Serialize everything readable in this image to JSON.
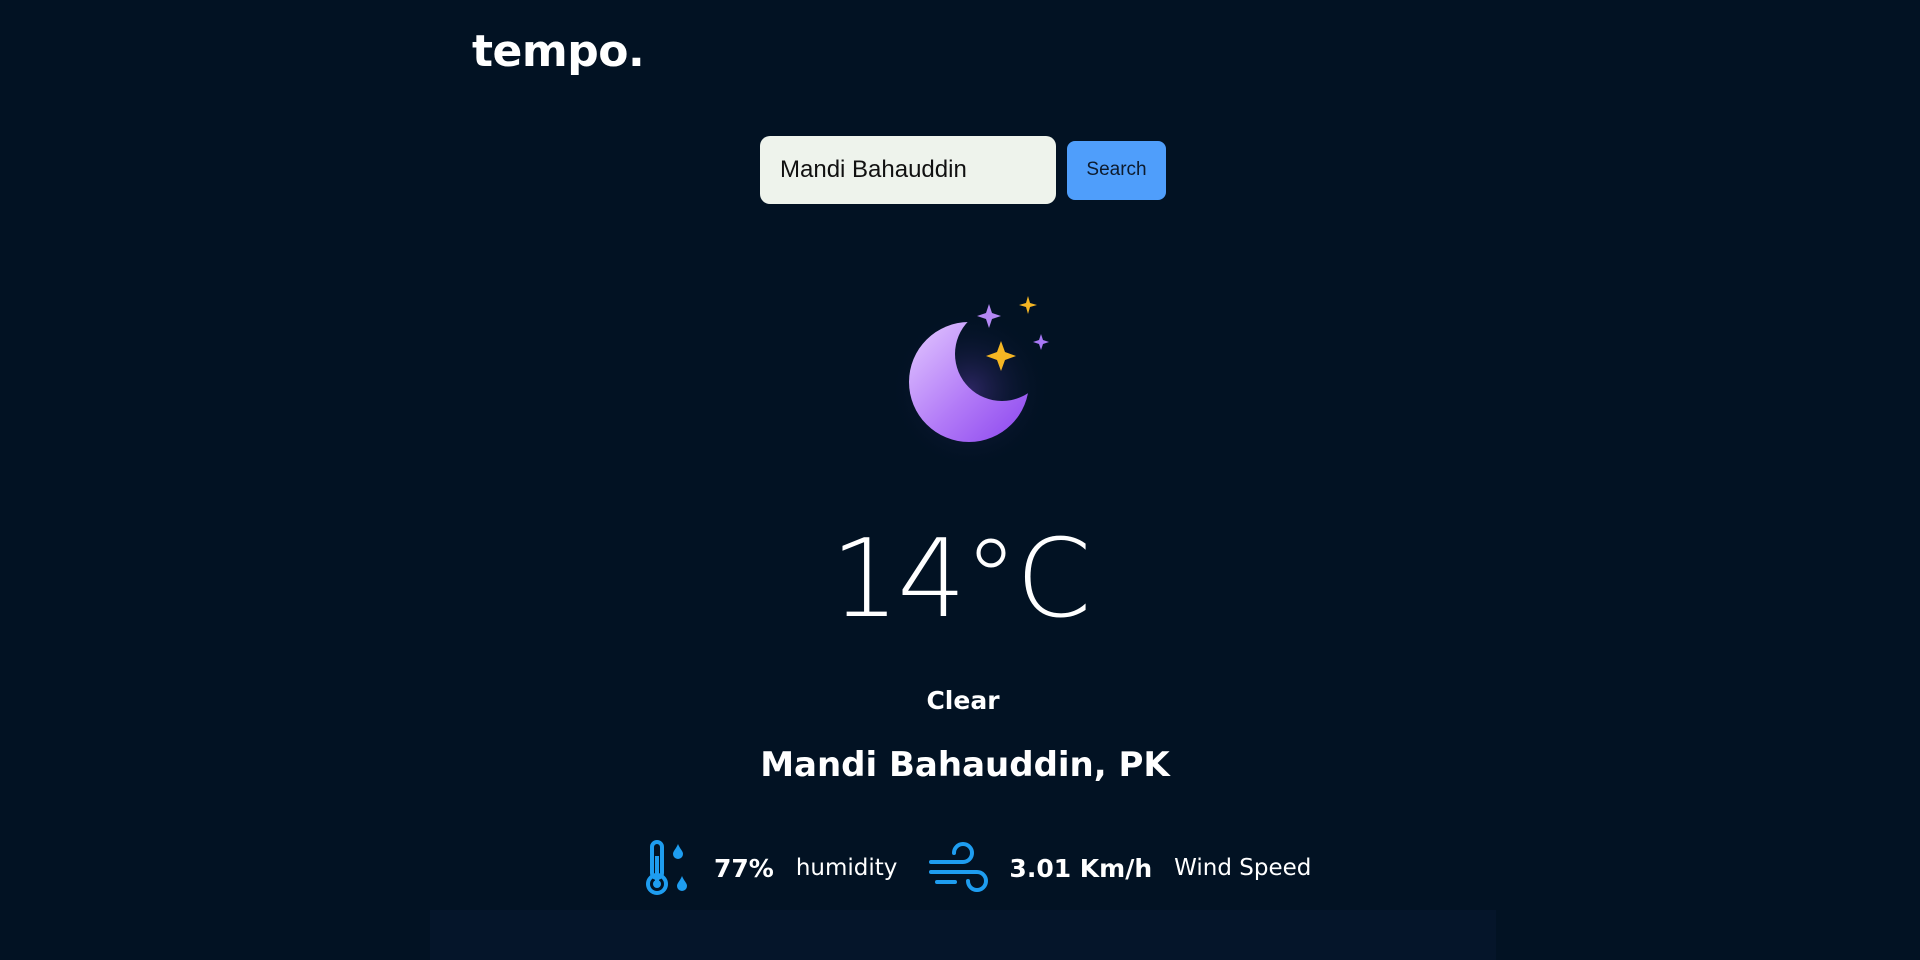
{
  "header": {
    "logo": "tempo."
  },
  "search": {
    "value": "Mandi Bahauddin",
    "button_label": "Search"
  },
  "weather": {
    "icon": "moon-stars-icon",
    "temperature": "14°C",
    "condition": "Clear",
    "location": "Mandi Bahauddin, PK"
  },
  "stats": {
    "humidity": {
      "icon": "thermometer-droplets-icon",
      "value": "77%",
      "label": "humidity"
    },
    "wind": {
      "icon": "wind-icon",
      "value": "3.01 Km/h",
      "label": "Wind Speed"
    }
  },
  "colors": {
    "background": "#021223",
    "search_input_bg": "#eef3ec",
    "search_button_bg": "#4f9efb",
    "moon": "#a96cf6",
    "icon_blue": "#1e9df0"
  }
}
